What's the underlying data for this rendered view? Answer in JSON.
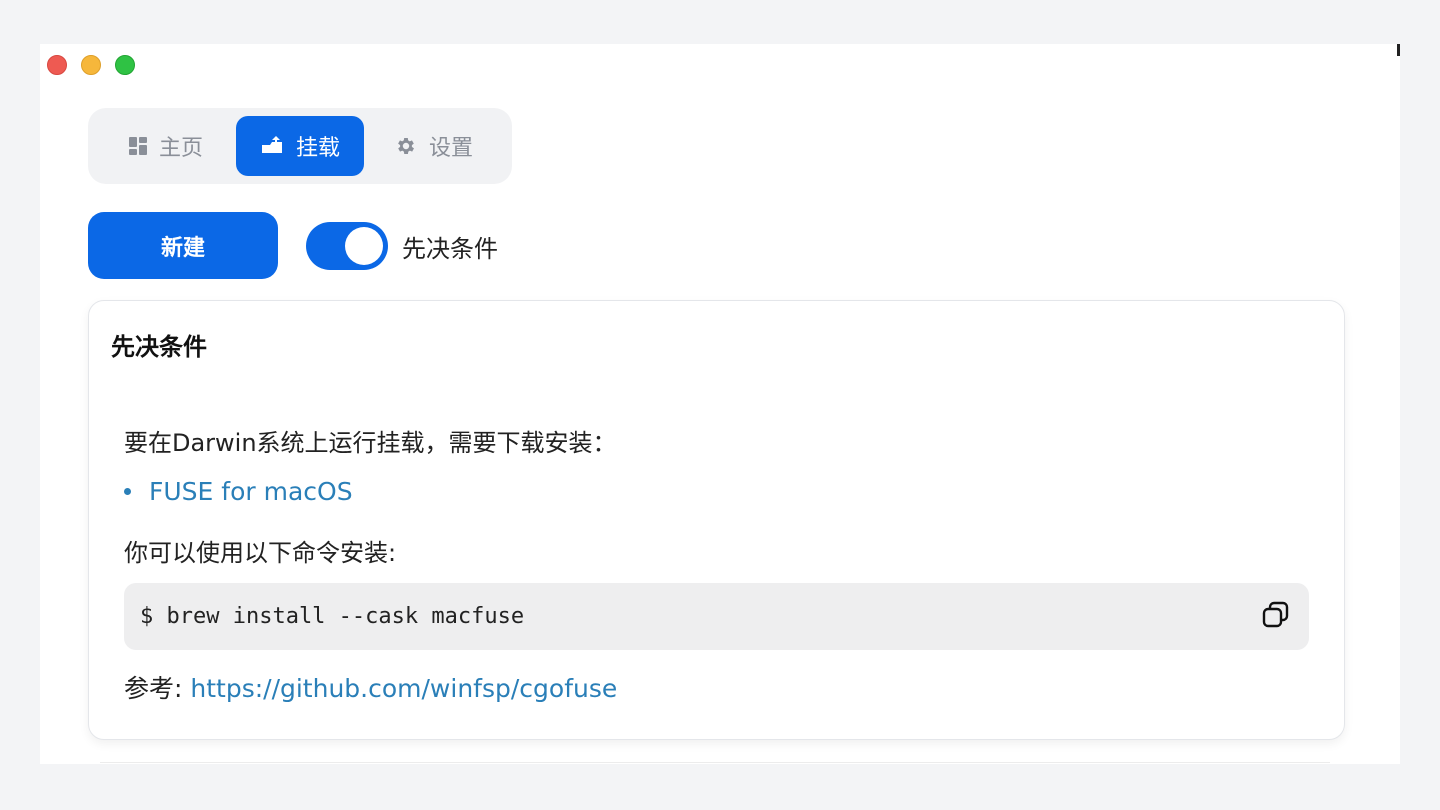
{
  "tabs": [
    {
      "label": "主页",
      "icon": "dashboard-icon"
    },
    {
      "label": "挂载",
      "icon": "mount-icon"
    },
    {
      "label": "设置",
      "icon": "gear-icon"
    }
  ],
  "active_tab": "挂载",
  "actions": {
    "new_label": "新建",
    "toggle_label": "先决条件",
    "toggle_on": true
  },
  "card": {
    "title": "先决条件",
    "intro": "要在Darwin系统上运行挂载，需要下载安装：",
    "links": [
      {
        "label": "FUSE for macOS"
      }
    ],
    "install_text": "你可以使用以下命令安装:",
    "code": "$ brew install --cask macfuse",
    "reference_label": "参考: ",
    "reference_url": "https://github.com/winfsp/cgofuse"
  },
  "colors": {
    "accent": "#0b68e6",
    "link": "#2a7fb8"
  }
}
